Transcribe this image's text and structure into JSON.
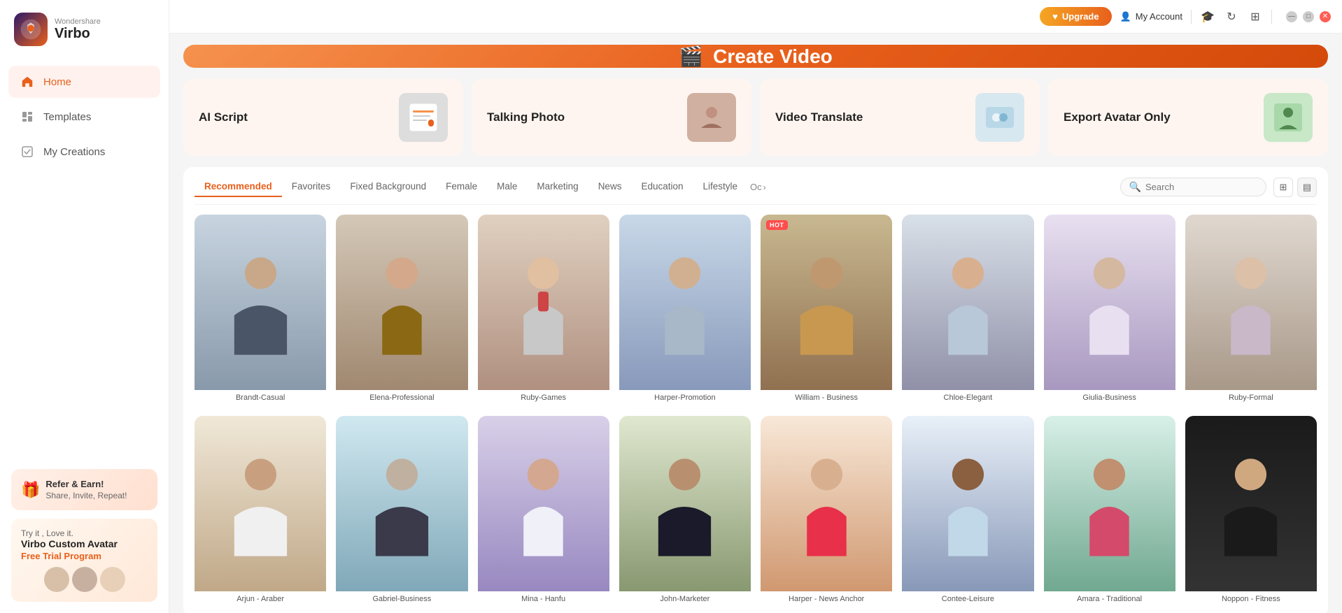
{
  "app": {
    "brand": "Wondershare",
    "name": "Virbo",
    "logo_gradient_start": "#2d1b69",
    "logo_gradient_end": "#e8601c"
  },
  "titlebar": {
    "upgrade_label": "Upgrade",
    "my_account_label": "My Account"
  },
  "sidebar": {
    "nav_items": [
      {
        "id": "home",
        "label": "Home",
        "active": true
      },
      {
        "id": "templates",
        "label": "Templates",
        "active": false
      },
      {
        "id": "my-creations",
        "label": "My Creations",
        "active": false
      }
    ],
    "promo1": {
      "title": "Refer & Earn!",
      "subtitle": "Share, Invite, Repeat!"
    },
    "promo2": {
      "try": "Try it , Love it.",
      "brand": "Virbo Custom Avatar",
      "tag": "Free Trial Program"
    }
  },
  "hero": {
    "label": "Create Video"
  },
  "features": [
    {
      "id": "ai-script",
      "label": "AI Script"
    },
    {
      "id": "talking-photo",
      "label": "Talking Photo"
    },
    {
      "id": "video-translate",
      "label": "Video Translate"
    },
    {
      "id": "export-avatar",
      "label": "Export Avatar Only"
    }
  ],
  "filter_tabs": [
    {
      "id": "recommended",
      "label": "Recommended",
      "active": true
    },
    {
      "id": "favorites",
      "label": "Favorites",
      "active": false
    },
    {
      "id": "fixed-bg",
      "label": "Fixed Background",
      "active": false
    },
    {
      "id": "female",
      "label": "Female",
      "active": false
    },
    {
      "id": "male",
      "label": "Male",
      "active": false
    },
    {
      "id": "marketing",
      "label": "Marketing",
      "active": false
    },
    {
      "id": "news",
      "label": "News",
      "active": false
    },
    {
      "id": "education",
      "label": "Education",
      "active": false
    },
    {
      "id": "lifestyle",
      "label": "Lifestyle",
      "active": false
    },
    {
      "id": "other",
      "label": "Oc",
      "active": false
    }
  ],
  "search": {
    "placeholder": "Search"
  },
  "avatars": [
    {
      "id": 1,
      "name": "Brandt-Casual",
      "class": "av1",
      "hot": false
    },
    {
      "id": 2,
      "name": "Elena-Professional",
      "class": "av2",
      "hot": false
    },
    {
      "id": 3,
      "name": "Ruby-Games",
      "class": "av3",
      "hot": false
    },
    {
      "id": 4,
      "name": "Harper-Promotion",
      "class": "av4",
      "hot": false
    },
    {
      "id": 5,
      "name": "William - Business",
      "class": "av5",
      "hot": true
    },
    {
      "id": 6,
      "name": "Chloe-Elegant",
      "class": "av6",
      "hot": false
    },
    {
      "id": 7,
      "name": "Giulia-Business",
      "class": "av7",
      "hot": false
    },
    {
      "id": 8,
      "name": "Ruby-Formal",
      "class": "av8",
      "hot": false
    },
    {
      "id": 9,
      "name": "Arjun - Araber",
      "class": "av9",
      "hot": false
    },
    {
      "id": 10,
      "name": "Gabriel-Business",
      "class": "av10",
      "hot": false
    },
    {
      "id": 11,
      "name": "Mina - Hanfu",
      "class": "av11",
      "hot": false
    },
    {
      "id": 12,
      "name": "John-Marketer",
      "class": "av12",
      "hot": false
    },
    {
      "id": 13,
      "name": "Harper - News Anchor",
      "class": "av13",
      "hot": false
    },
    {
      "id": 14,
      "name": "Contee-Leisure",
      "class": "av14",
      "hot": false
    },
    {
      "id": 15,
      "name": "Amara - Traditional",
      "class": "av15",
      "hot": false
    },
    {
      "id": 16,
      "name": "Noppon - Fitness",
      "class": "av16",
      "hot": false
    }
  ],
  "hot_badge": "HOT"
}
